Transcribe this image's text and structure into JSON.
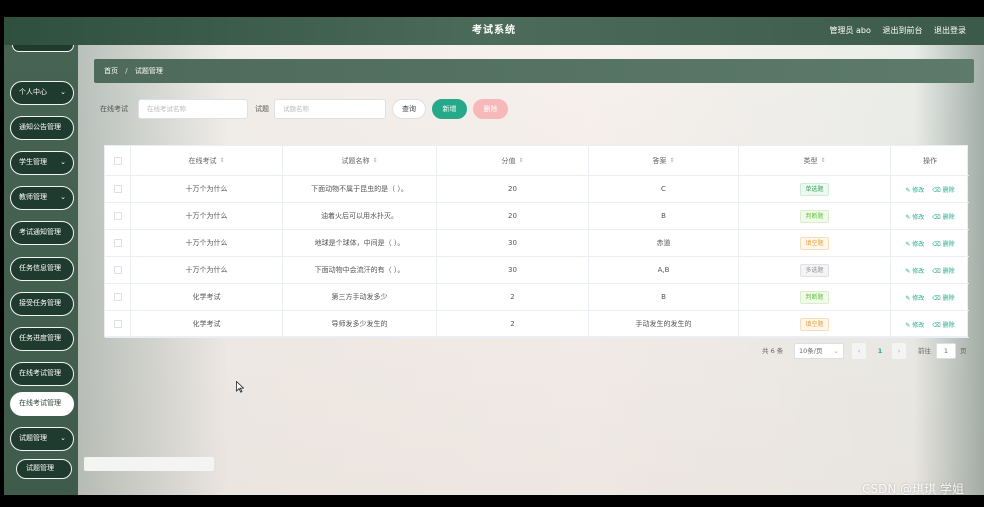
{
  "header": {
    "title": "考试系统",
    "admin": "管理员 abo",
    "back_label": "退出到前台",
    "logout_label": "退出登录"
  },
  "sidebar": {
    "items": [
      {
        "label": "个人中心",
        "has_chevron": true
      },
      {
        "label": "通知公告管理",
        "has_chevron": false
      },
      {
        "label": "学生管理",
        "has_chevron": true
      },
      {
        "label": "教师管理",
        "has_chevron": true
      },
      {
        "label": "考试通知管理",
        "has_chevron": false
      },
      {
        "label": "任务信息管理",
        "has_chevron": false
      },
      {
        "label": "接受任务管理",
        "has_chevron": false
      },
      {
        "label": "任务进度管理",
        "has_chevron": false
      },
      {
        "label": "在线考试管理",
        "has_chevron": false
      },
      {
        "label": "在线考试管理",
        "has_chevron": false,
        "active": true
      },
      {
        "label": "试题管理",
        "has_chevron": true
      },
      {
        "label": "试题管理",
        "sub": true
      },
      {
        "label": "系统管理",
        "has_chevron": true
      }
    ],
    "chevron": "chevron-down-icon"
  },
  "breadcrumb": {
    "home": "首页",
    "separator": "/",
    "current": "试题管理"
  },
  "search": {
    "exam_label": "在线考试",
    "exam_placeholder": "在线考试名称",
    "question_label": "试题",
    "question_placeholder": "试题名称",
    "query_label": "查询",
    "add_label": "新增",
    "delete_label": "删除"
  },
  "table": {
    "columns": [
      "在线考试",
      "试题名称",
      "分值",
      "答案",
      "类型",
      "操作"
    ],
    "sort_glyph": "⇕",
    "edit_label": "修改",
    "delete_label": "删除",
    "rows": [
      {
        "exam": "十万个为什么",
        "question": "下面动物不属于昆虫的是（ ）。",
        "score": "20",
        "answer": "C",
        "type": "单选题",
        "type_kind": "single"
      },
      {
        "exam": "十万个为什么",
        "question": "油着火后可以用水扑灭。",
        "score": "20",
        "answer": "B",
        "type": "判断题",
        "type_kind": "judge"
      },
      {
        "exam": "十万个为什么",
        "question": "地球是个球体，中间是（ ）。",
        "score": "30",
        "answer": "赤道",
        "type": "填空题",
        "type_kind": "fill"
      },
      {
        "exam": "十万个为什么",
        "question": "下面动物中会流汗的有（ ）。",
        "score": "30",
        "answer": "A,B",
        "type": "多选题",
        "type_kind": "multi"
      },
      {
        "exam": "化学考试",
        "question": "第三方手动发多少",
        "score": "2",
        "answer": "B",
        "type": "判断题",
        "type_kind": "judge"
      },
      {
        "exam": "化学考试",
        "question": "导师发多少发生的",
        "score": "2",
        "answer": "手动发生的发生的",
        "type": "填空题",
        "type_kind": "fill"
      }
    ]
  },
  "pagination": {
    "total": "共 6 条",
    "page_size": "10条/页",
    "prev": "‹",
    "current_page": "1",
    "next": "›",
    "goto_label": "前往",
    "goto_value": "1",
    "page_unit": "页"
  },
  "watermark": "CSDN @琪琪 学姐",
  "colors": {
    "header": "#3c5a4a",
    "sidebar": "#476352",
    "menu_item": "#1f3a2e",
    "accent": "#26a98a",
    "delete_button": "#f6b8b8"
  }
}
